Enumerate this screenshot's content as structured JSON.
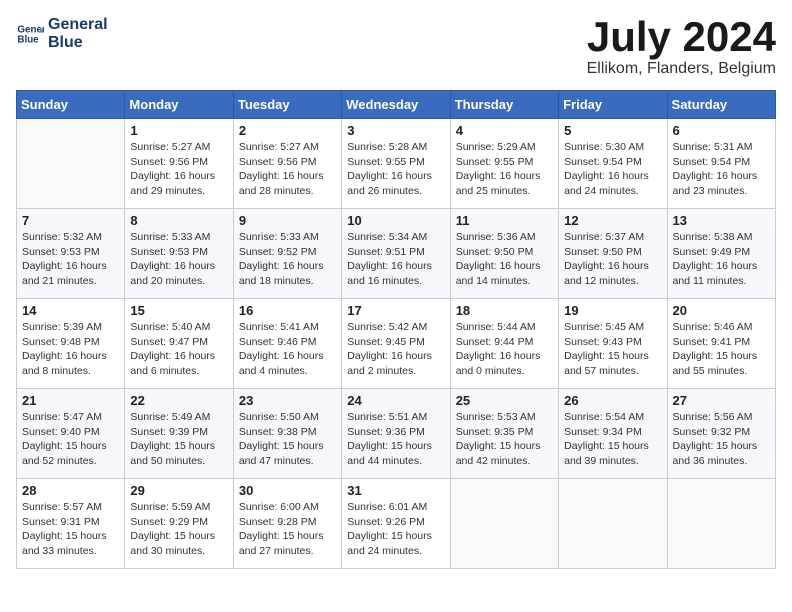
{
  "header": {
    "logo_line1": "General",
    "logo_line2": "Blue",
    "title": "July 2024",
    "subtitle": "Ellikom, Flanders, Belgium"
  },
  "calendar": {
    "days_of_week": [
      "Sunday",
      "Monday",
      "Tuesday",
      "Wednesday",
      "Thursday",
      "Friday",
      "Saturday"
    ],
    "weeks": [
      [
        {
          "day": "",
          "info": ""
        },
        {
          "day": "1",
          "info": "Sunrise: 5:27 AM\nSunset: 9:56 PM\nDaylight: 16 hours\nand 29 minutes."
        },
        {
          "day": "2",
          "info": "Sunrise: 5:27 AM\nSunset: 9:56 PM\nDaylight: 16 hours\nand 28 minutes."
        },
        {
          "day": "3",
          "info": "Sunrise: 5:28 AM\nSunset: 9:55 PM\nDaylight: 16 hours\nand 26 minutes."
        },
        {
          "day": "4",
          "info": "Sunrise: 5:29 AM\nSunset: 9:55 PM\nDaylight: 16 hours\nand 25 minutes."
        },
        {
          "day": "5",
          "info": "Sunrise: 5:30 AM\nSunset: 9:54 PM\nDaylight: 16 hours\nand 24 minutes."
        },
        {
          "day": "6",
          "info": "Sunrise: 5:31 AM\nSunset: 9:54 PM\nDaylight: 16 hours\nand 23 minutes."
        }
      ],
      [
        {
          "day": "7",
          "info": "Sunrise: 5:32 AM\nSunset: 9:53 PM\nDaylight: 16 hours\nand 21 minutes."
        },
        {
          "day": "8",
          "info": "Sunrise: 5:33 AM\nSunset: 9:53 PM\nDaylight: 16 hours\nand 20 minutes."
        },
        {
          "day": "9",
          "info": "Sunrise: 5:33 AM\nSunset: 9:52 PM\nDaylight: 16 hours\nand 18 minutes."
        },
        {
          "day": "10",
          "info": "Sunrise: 5:34 AM\nSunset: 9:51 PM\nDaylight: 16 hours\nand 16 minutes."
        },
        {
          "day": "11",
          "info": "Sunrise: 5:36 AM\nSunset: 9:50 PM\nDaylight: 16 hours\nand 14 minutes."
        },
        {
          "day": "12",
          "info": "Sunrise: 5:37 AM\nSunset: 9:50 PM\nDaylight: 16 hours\nand 12 minutes."
        },
        {
          "day": "13",
          "info": "Sunrise: 5:38 AM\nSunset: 9:49 PM\nDaylight: 16 hours\nand 11 minutes."
        }
      ],
      [
        {
          "day": "14",
          "info": "Sunrise: 5:39 AM\nSunset: 9:48 PM\nDaylight: 16 hours\nand 8 minutes."
        },
        {
          "day": "15",
          "info": "Sunrise: 5:40 AM\nSunset: 9:47 PM\nDaylight: 16 hours\nand 6 minutes."
        },
        {
          "day": "16",
          "info": "Sunrise: 5:41 AM\nSunset: 9:46 PM\nDaylight: 16 hours\nand 4 minutes."
        },
        {
          "day": "17",
          "info": "Sunrise: 5:42 AM\nSunset: 9:45 PM\nDaylight: 16 hours\nand 2 minutes."
        },
        {
          "day": "18",
          "info": "Sunrise: 5:44 AM\nSunset: 9:44 PM\nDaylight: 16 hours\nand 0 minutes."
        },
        {
          "day": "19",
          "info": "Sunrise: 5:45 AM\nSunset: 9:43 PM\nDaylight: 15 hours\nand 57 minutes."
        },
        {
          "day": "20",
          "info": "Sunrise: 5:46 AM\nSunset: 9:41 PM\nDaylight: 15 hours\nand 55 minutes."
        }
      ],
      [
        {
          "day": "21",
          "info": "Sunrise: 5:47 AM\nSunset: 9:40 PM\nDaylight: 15 hours\nand 52 minutes."
        },
        {
          "day": "22",
          "info": "Sunrise: 5:49 AM\nSunset: 9:39 PM\nDaylight: 15 hours\nand 50 minutes."
        },
        {
          "day": "23",
          "info": "Sunrise: 5:50 AM\nSunset: 9:38 PM\nDaylight: 15 hours\nand 47 minutes."
        },
        {
          "day": "24",
          "info": "Sunrise: 5:51 AM\nSunset: 9:36 PM\nDaylight: 15 hours\nand 44 minutes."
        },
        {
          "day": "25",
          "info": "Sunrise: 5:53 AM\nSunset: 9:35 PM\nDaylight: 15 hours\nand 42 minutes."
        },
        {
          "day": "26",
          "info": "Sunrise: 5:54 AM\nSunset: 9:34 PM\nDaylight: 15 hours\nand 39 minutes."
        },
        {
          "day": "27",
          "info": "Sunrise: 5:56 AM\nSunset: 9:32 PM\nDaylight: 15 hours\nand 36 minutes."
        }
      ],
      [
        {
          "day": "28",
          "info": "Sunrise: 5:57 AM\nSunset: 9:31 PM\nDaylight: 15 hours\nand 33 minutes."
        },
        {
          "day": "29",
          "info": "Sunrise: 5:59 AM\nSunset: 9:29 PM\nDaylight: 15 hours\nand 30 minutes."
        },
        {
          "day": "30",
          "info": "Sunrise: 6:00 AM\nSunset: 9:28 PM\nDaylight: 15 hours\nand 27 minutes."
        },
        {
          "day": "31",
          "info": "Sunrise: 6:01 AM\nSunset: 9:26 PM\nDaylight: 15 hours\nand 24 minutes."
        },
        {
          "day": "",
          "info": ""
        },
        {
          "day": "",
          "info": ""
        },
        {
          "day": "",
          "info": ""
        }
      ]
    ]
  }
}
